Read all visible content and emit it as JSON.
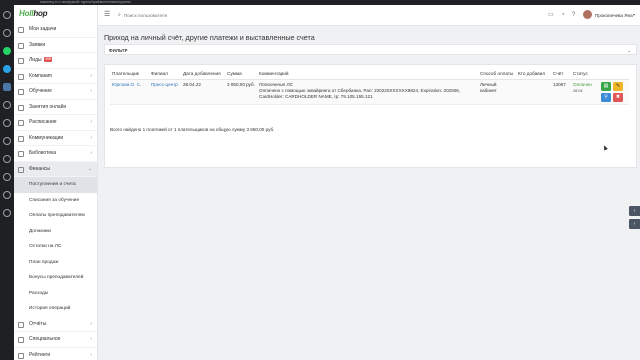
{
  "browser": {
    "url_fragment": "наконец-то с выгрузкой: курсы/приёмы/оплаты/группы"
  },
  "app": {
    "logo_part1": "Holl",
    "logo_part2": "hop"
  },
  "header": {
    "search_icon": "search-icon",
    "search_placeholder": "Поиск пользователя",
    "username": "Прокопичева Яна"
  },
  "sidebar": {
    "items": [
      {
        "label": "Мои задачи",
        "icon": "tasks-icon"
      },
      {
        "label": "Заявки",
        "icon": "requests-icon"
      },
      {
        "label": "Лиды",
        "icon": "leads-icon",
        "badge": "498"
      },
      {
        "label": "Компания",
        "icon": "company-icon"
      },
      {
        "label": "Обучение",
        "icon": "education-icon"
      },
      {
        "label": "Занятия онлайн",
        "icon": "online-lessons-icon"
      },
      {
        "label": "Расписание",
        "icon": "schedule-icon"
      },
      {
        "label": "Коммуникации",
        "icon": "communications-icon"
      },
      {
        "label": "Библиотека",
        "icon": "library-icon"
      },
      {
        "label": "Финансы",
        "icon": "finance-icon"
      }
    ],
    "finance_sub": [
      "Поступления и счета",
      "Списания за обучение",
      "Оплаты преподавателям",
      "Должники",
      "Остатки на ЛС",
      "План продаж",
      "Бонусы преподавателей",
      "Расходы",
      "История операций"
    ],
    "bottom_items": [
      {
        "label": "Отчёты",
        "icon": "reports-icon"
      },
      {
        "label": "Специальное",
        "icon": "special-icon"
      },
      {
        "label": "Рейтинги",
        "icon": "ratings-icon"
      }
    ]
  },
  "page": {
    "title": "Приход на личный счёт, другие платежи и выставленные счета",
    "filter_label": "ФИЛЬТР"
  },
  "table": {
    "headers": {
      "payer": "Плательщик",
      "branch": "Филиал",
      "date_added": "Дата добавления",
      "amount": "Сумма",
      "comment": "Комментарий",
      "method": "Способ оплаты",
      "added_by": "Кто добавил",
      "invoice": "Счёт",
      "status": "Статус"
    },
    "rows": [
      {
        "payer": "Юрлова О. С.",
        "branch": "Пресс-центр",
        "date": "28.04.22",
        "amount": "3 850,00 руб.",
        "comment_title": "Пополнение ЛС",
        "comment_body": "Оплачено с помощью эквайринга от Сбербанка. Pan: 220220XXXXXX9824, Expiration: 202506, CardHolder: CARDHOLDER NAME, Ip: 79.105.155.121",
        "method": "Личный кабинет",
        "added_by": "",
        "invoice": "13087",
        "status": "Оплачен",
        "status_date": "28.04"
      }
    ]
  },
  "summary": "Всего найдено 1 платежей от 1 плательщиков на общую сумму 3 850,00 руб.",
  "colors": {
    "accent_green": "#3aa64a",
    "link_blue": "#2a73b8",
    "status_green": "#3c9a3c",
    "badge_red": "#e04f4f"
  }
}
